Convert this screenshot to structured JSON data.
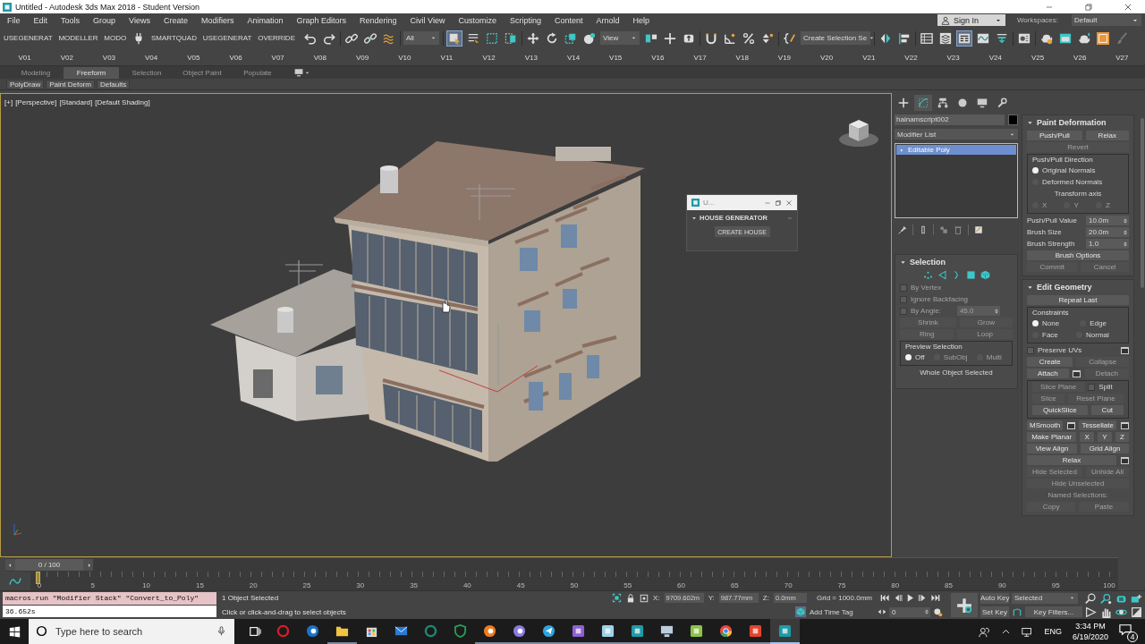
{
  "window": {
    "title": "Untitled - Autodesk 3ds Max 2018 - Student Version"
  },
  "menu": [
    "File",
    "Edit",
    "Tools",
    "Group",
    "Views",
    "Create",
    "Modifiers",
    "Animation",
    "Graph Editors",
    "Rendering",
    "Civil View",
    "Customize",
    "Scripting",
    "Content",
    "Arnold",
    "Help"
  ],
  "account": "Sign In",
  "workspaces": {
    "label": "Workspaces:",
    "value": "Default"
  },
  "toolbar": {
    "scripts": [
      {
        "kind": "text",
        "label": "USEGENERAT"
      },
      {
        "kind": "text",
        "label": "MODELLER"
      },
      {
        "kind": "text",
        "label": "MODO"
      },
      {
        "kind": "icon"
      },
      {
        "kind": "text",
        "label": "SMARTQUAD"
      },
      {
        "kind": "text",
        "label": "USEGENERAT"
      },
      {
        "kind": "text",
        "label": "OVERRIDE"
      }
    ],
    "selection_filter": "All",
    "reference_coord": "View",
    "named_selection": "Create Selection Se",
    "select_object_on": true,
    "ribbon_on": true
  },
  "viewport_buttons": [
    "V01",
    "V02",
    "V03",
    "V04",
    "V05",
    "V06",
    "V07",
    "V08",
    "V09",
    "V10",
    "V11",
    "V12",
    "V13",
    "V14",
    "V15",
    "V16",
    "V17",
    "V18",
    "V19",
    "V20",
    "V21",
    "V22",
    "V23",
    "V24",
    "V25",
    "V26",
    "V27"
  ],
  "ribbon": {
    "tabs": [
      {
        "label": "Modeling",
        "selected": false
      },
      {
        "label": "Freeform",
        "selected": true
      },
      {
        "label": "Selection",
        "selected": false
      },
      {
        "label": "Object Paint",
        "selected": false
      },
      {
        "label": "Populate",
        "selected": false
      }
    ],
    "panel": [
      "PolyDraw",
      "Paint Deform",
      "Defaults"
    ]
  },
  "viewport": {
    "labels": [
      "[+]",
      "[Perspective]",
      "[Standard]",
      "[Default Shading]"
    ]
  },
  "dialog": {
    "title": "U...",
    "rollout": "HOUSE GENERATOR",
    "button": "CREATE HOUSE"
  },
  "command_panel": {
    "tabs": [
      {
        "selected": false
      },
      {
        "selected": true
      },
      {
        "selected": false
      },
      {
        "selected": false
      },
      {
        "selected": false
      },
      {
        "selected": false
      }
    ],
    "object_name": "hainamscript002",
    "modifier_list": "Modifier List",
    "stack": [
      {
        "label": "Editable Poly",
        "selected": true
      }
    ],
    "selection": {
      "title": "Selection",
      "rows": [
        [
          {
            "kind": "check",
            "label": "By Vertex",
            "checked": false,
            "disabled": true
          }
        ],
        [
          {
            "kind": "check",
            "label": "Ignore Backfacing",
            "checked": false,
            "disabled": true
          }
        ],
        [
          {
            "kind": "check",
            "label": "By Angle:",
            "checked": false,
            "disabled": true
          },
          {
            "kind": "spinner",
            "value": "45.0",
            "disabled": true
          }
        ],
        [
          {
            "kind": "button",
            "label": "Shrink",
            "disabled": true
          },
          {
            "kind": "button",
            "label": "Grow",
            "disabled": true
          }
        ],
        [
          {
            "kind": "button",
            "label": "Ring",
            "disabled": true
          },
          {
            "kind": "button",
            "label": "Loop",
            "disabled": true
          }
        ],
        [
          {
            "kind": "group",
            "title": "Preview Selection",
            "rows": [
              [
                {
                  "kind": "radio",
                  "label": "Off",
                  "selected": true,
                  "disabled": false
                },
                {
                  "kind": "radio",
                  "label": "SubObj",
                  "selected": false,
                  "disabled": true
                },
                {
                  "kind": "radio",
                  "label": "Multi",
                  "selected": false,
                  "disabled": true
                }
              ]
            ]
          }
        ],
        [
          {
            "kind": "text",
            "label": "Whole Object Selected",
            "disabled": false
          }
        ]
      ]
    },
    "paint_deformation": {
      "title": "Paint Deformation",
      "rows": [
        [
          {
            "kind": "button",
            "label": "Push/Pull",
            "disabled": false
          },
          {
            "kind": "button",
            "label": "Relax",
            "disabled": false
          }
        ],
        [
          {
            "kind": "button",
            "label": "Revert",
            "disabled": true
          }
        ],
        [
          {
            "kind": "group",
            "title": "Push/Pull Direction",
            "rows": [
              [
                {
                  "kind": "radio",
                  "label": "Original Normals",
                  "selected": true,
                  "disabled": false
                }
              ],
              [
                {
                  "kind": "radio",
                  "label": "Deformed Normals",
                  "selected": false,
                  "disabled": false
                }
              ],
              [
                {
                  "kind": "text",
                  "label": "Transform axis",
                  "disabled": false
                }
              ],
              [
                {
                  "kind": "radio",
                  "label": "X",
                  "selected": false,
                  "disabled": true
                },
                {
                  "kind": "radio",
                  "label": "Y",
                  "selected": false,
                  "disabled": true
                },
                {
                  "kind": "radio",
                  "label": "Z",
                  "selected": false,
                  "disabled": true
                }
              ]
            ]
          }
        ],
        [
          {
            "kind": "spinner",
            "label": "Push/Pull Value",
            "value": "10.0m",
            "disabled": false
          }
        ],
        [
          {
            "kind": "spinner",
            "label": "Brush Size",
            "value": "20.0m",
            "disabled": false
          }
        ],
        [
          {
            "kind": "spinner",
            "label": "Brush Strength",
            "value": "1.0",
            "disabled": false
          }
        ],
        [
          {
            "kind": "button",
            "label": "Brush Options",
            "disabled": false
          }
        ],
        [
          {
            "kind": "button",
            "label": "Commit",
            "disabled": true
          },
          {
            "kind": "button",
            "label": "Cancel",
            "disabled": true
          }
        ]
      ]
    },
    "edit_geometry": {
      "title": "Edit Geometry",
      "rows": [
        [
          {
            "kind": "button",
            "label": "Repeat Last",
            "disabled": false
          }
        ],
        [
          {
            "kind": "group",
            "title": "Constraints",
            "rows": [
              [
                {
                  "kind": "radio",
                  "label": "None",
                  "selected": true,
                  "disabled": false
                },
                {
                  "kind": "radio",
                  "label": "Edge",
                  "selected": false,
                  "disabled": false
                }
              ],
              [
                {
                  "kind": "radio",
                  "label": "Face",
                  "selected": false,
                  "disabled": false
                },
                {
                  "kind": "radio",
                  "label": "Normal",
                  "selected": false,
                  "disabled": false
                }
              ]
            ]
          }
        ],
        [
          {
            "kind": "check",
            "label": "Preserve UVs",
            "checked": false,
            "disabled": false
          },
          {
            "kind": "settings"
          }
        ],
        [
          {
            "kind": "button",
            "label": "Create",
            "disabled": false
          },
          {
            "kind": "button",
            "label": "Collapse",
            "disabled": true
          }
        ],
        [
          {
            "kind": "button",
            "label": "Attach",
            "disabled": false
          },
          {
            "kind": "settings"
          },
          {
            "kind": "button",
            "label": "Detach",
            "disabled": true
          }
        ],
        [
          {
            "kind": "group",
            "rows": [
              [
                {
                  "kind": "button",
                  "label": "Slice Plane",
                  "disabled": true
                },
                {
                  "kind": "check",
                  "label": "Split",
                  "checked": false,
                  "disabled": false
                }
              ],
              [
                {
                  "kind": "button",
                  "label": "Slice",
                  "disabled": true
                },
                {
                  "kind": "button",
                  "label": "Reset Plane",
                  "disabled": true
                }
              ],
              [
                {
                  "kind": "button",
                  "label": "QuickSlice",
                  "disabled": false
                },
                {
                  "kind": "button",
                  "label": "Cut",
                  "disabled": false
                }
              ]
            ]
          }
        ],
        [
          {
            "kind": "button",
            "label": "MSmooth",
            "disabled": false
          },
          {
            "kind": "settings"
          },
          {
            "kind": "button",
            "label": "Tessellate",
            "disabled": false
          },
          {
            "kind": "settings"
          }
        ],
        [
          {
            "kind": "button",
            "label": "Make Planar",
            "disabled": false
          },
          {
            "kind": "button",
            "label": "X",
            "disabled": false
          },
          {
            "kind": "button",
            "label": "Y",
            "disabled": false
          },
          {
            "kind": "button",
            "label": "Z",
            "disabled": false
          }
        ],
        [
          {
            "kind": "button",
            "label": "View Align",
            "disabled": false
          },
          {
            "kind": "button",
            "label": "Grid Align",
            "disabled": false
          }
        ],
        [
          {
            "kind": "button",
            "label": "Relax",
            "disabled": false
          },
          {
            "kind": "settings"
          }
        ],
        [
          {
            "kind": "button",
            "label": "Hide Selected",
            "disabled": true
          },
          {
            "kind": "button",
            "label": "Unhide All",
            "disabled": true
          }
        ],
        [
          {
            "kind": "button",
            "label": "Hide Unselected",
            "disabled": true
          }
        ],
        [
          {
            "kind": "text",
            "label": "Named Selections:",
            "disabled": true
          }
        ],
        [
          {
            "kind": "button",
            "label": "Copy",
            "disabled": true
          },
          {
            "kind": "button",
            "label": "Paste",
            "disabled": true
          }
        ]
      ]
    }
  },
  "timeline": {
    "frame": "0 / 100",
    "level": 0,
    "ticks": [
      "0",
      "5",
      "10",
      "15",
      "20",
      "25",
      "30",
      "35",
      "40",
      "45",
      "50",
      "55",
      "60",
      "65",
      "70",
      "75",
      "80",
      "85",
      "90",
      "95",
      "100"
    ]
  },
  "status_bar": {
    "listener_input": "macros.run \"Modifier Stack\" \"Convert_to_Poly\"",
    "listener_output": "36.652s",
    "selection": "1 Object Selected",
    "prompt": "Click or click-and-drag to select objects",
    "coords": [
      {
        "label": "X:",
        "value": "9709.602m"
      },
      {
        "label": "Y:",
        "value": "987.77mm"
      },
      {
        "label": "Z:",
        "value": "0.0mm"
      }
    ],
    "grid": "Grid = 1000.0mm",
    "time_tag": "Add Time Tag",
    "frame": "0",
    "auto_key": "Auto Key",
    "key_set": "Selected",
    "set_key": "Set Key",
    "key_filters": "Key Filters..."
  },
  "taskbar": {
    "search_placeholder": "Type here to search",
    "apps": [
      {
        "running": false,
        "active": false
      },
      {
        "running": false,
        "active": false
      },
      {
        "running": true,
        "active": false
      },
      {
        "running": false,
        "active": false
      },
      {
        "running": false,
        "active": false
      },
      {
        "running": false,
        "active": false
      },
      {
        "running": false,
        "active": false
      },
      {
        "running": true,
        "active": false
      },
      {
        "running": true,
        "active": false
      },
      {
        "running": true,
        "active": false
      },
      {
        "running": true,
        "active": false
      },
      {
        "running": true,
        "active": false
      },
      {
        "running": true,
        "active": false
      },
      {
        "running": true,
        "active": false
      },
      {
        "running": true,
        "active": false
      },
      {
        "running": true,
        "active": false
      },
      {
        "running": true,
        "active": false
      },
      {
        "running": true,
        "active": true
      }
    ],
    "language": "ENG",
    "time": "3:34 PM",
    "date": "6/19/2020",
    "notifications": "4"
  }
}
